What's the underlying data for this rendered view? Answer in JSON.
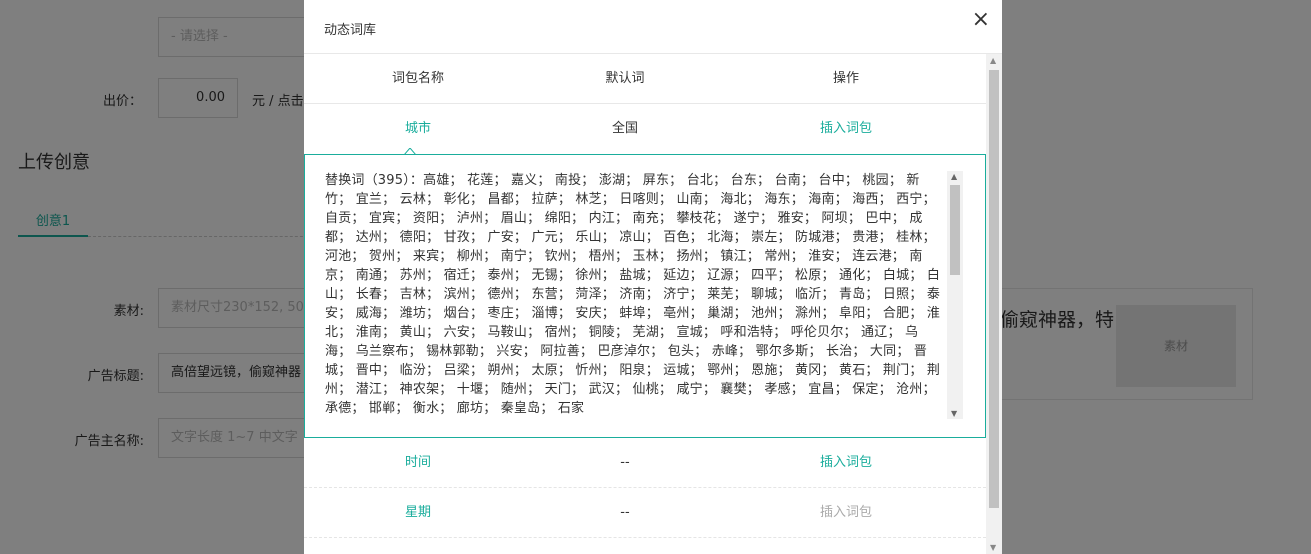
{
  "background": {
    "select_placeholder": "- 请选择 -",
    "bid_label": "出价：",
    "bid_value": "0.00",
    "bid_unit": "元 / 点击",
    "section_title": "上传创意",
    "creative_tab": "创意1",
    "material_label": "素材:",
    "material_placeholder": "素材尺寸230*152, 50",
    "ad_title_label": "广告标题:",
    "ad_title_value": "高倍望远镜，偷窥神器",
    "advertiser_label": "广告主名称:",
    "advertiser_placeholder": "文字长度 1~7 中文字",
    "preview_text": "偷窥神器，特",
    "preview_thumb_label": "素材"
  },
  "modal": {
    "title": "动态词库",
    "close": "×",
    "columns": [
      "词包名称",
      "默认词",
      "操作"
    ],
    "rows": [
      {
        "name": "城市",
        "default": "全国",
        "action": "插入词包",
        "action_state": "enabled"
      },
      {
        "name": "时间",
        "default": "--",
        "action": "插入词包",
        "action_state": "enabled"
      },
      {
        "name": "星期",
        "default": "--",
        "action": "插入词包",
        "action_state": "disabled"
      }
    ],
    "replacement_words": "替换词（395）：高雄； 花莲； 嘉义； 南投； 澎湖； 屏东； 台北； 台东； 台南； 台中； 桃园； 新竹； 宜兰； 云林； 彰化； 昌都； 拉萨； 林芝； 日喀则； 山南； 海北； 海东； 海南； 海西； 西宁； 自贡； 宜宾； 资阳； 泸州； 眉山； 绵阳； 内江； 南充； 攀枝花； 遂宁； 雅安； 阿坝； 巴中； 成都； 达州； 德阳； 甘孜； 广安； 广元； 乐山； 凉山； 百色； 北海； 崇左； 防城港； 贵港； 桂林； 河池； 贺州； 来宾； 柳州； 南宁； 钦州； 梧州； 玉林； 扬州； 镇江； 常州； 淮安； 连云港； 南京； 南通； 苏州； 宿迁； 泰州； 无锡； 徐州； 盐城； 延边； 辽源； 四平； 松原； 通化； 白城； 白山； 长春； 吉林； 滨州； 德州； 东营； 菏泽； 济南； 济宁； 莱芜； 聊城； 临沂； 青岛； 日照； 泰安； 威海； 潍坊； 烟台； 枣庄； 淄博； 安庆； 蚌埠； 亳州； 巢湖； 池州； 滁州； 阜阳； 合肥； 淮北； 淮南； 黄山； 六安； 马鞍山； 宿州； 铜陵； 芜湖； 宣城； 呼和浩特； 呼伦贝尔； 通辽； 乌海； 乌兰察布； 锡林郭勒； 兴安； 阿拉善； 巴彦淖尔； 包头； 赤峰； 鄂尔多斯； 长治； 大同； 晋城； 晋中； 临汾； 吕梁； 朔州； 太原； 忻州； 阳泉； 运城； 鄂州； 恩施； 黄冈； 黄石； 荆门； 荆州； 潜江； 神农架； 十堰； 随州； 天门； 武汉； 仙桃； 咸宁； 襄樊； 孝感； 宜昌； 保定； 沧州； 承德； 邯郸； 衡水； 廊坊； 秦皇岛； 石家"
  },
  "colors": {
    "accent": "#1aad9c",
    "overlay": "rgba(0,0,0,0.5)"
  }
}
